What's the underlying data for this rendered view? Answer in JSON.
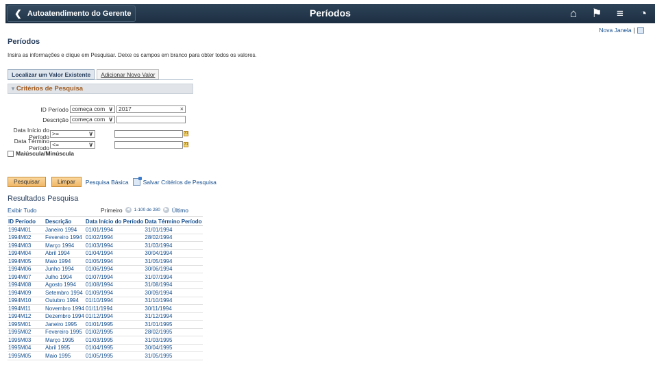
{
  "banner": {
    "back_label": "Autoatendimento do Gerente",
    "title": "Períodos",
    "icons": [
      "home-icon",
      "flag-icon",
      "menu-icon",
      "compass-icon"
    ]
  },
  "new_window": {
    "label": "Nova Janela",
    "separator": "|"
  },
  "page": {
    "title": "Períodos",
    "instructions": "Insira as informações e clique em Pesquisar. Deixe os campos em branco para obter todos os valores."
  },
  "tabs": {
    "find": "Localizar um Valor Existente",
    "add": "Adicionar Novo Valor"
  },
  "criteria": {
    "header": "Critérios de Pesquisa",
    "id": {
      "label": "ID Período",
      "op": "começa com",
      "value": "2017"
    },
    "desc": {
      "label": "Descrição",
      "op": "começa com",
      "value": ""
    },
    "start": {
      "label": "Data Início do Período",
      "op": ">=",
      "value": ""
    },
    "end": {
      "label": "Data Término Período",
      "op": "<=",
      "value": ""
    },
    "case_label": "Maiúscula/Minúscula"
  },
  "buttons": {
    "search": "Pesquisar",
    "clear": "Limpar",
    "basic": "Pesquisa Básica",
    "save": "Salvar Critérios de Pesquisa"
  },
  "results": {
    "title": "Resultados Pesquisa",
    "show_all": "Exibir Tudo",
    "first": "Primeiro",
    "range": "1-100 de 280",
    "last": "Último",
    "headers": [
      "ID Período",
      "Descrição",
      "Data Início do Período",
      "Data Término Período"
    ],
    "rows": [
      [
        "1994M01",
        "Janeiro 1994",
        "01/01/1994",
        "31/01/1994"
      ],
      [
        "1994M02",
        "Fevereiro 1994",
        "01/02/1994",
        "28/02/1994"
      ],
      [
        "1994M03",
        "Março 1994",
        "01/03/1994",
        "31/03/1994"
      ],
      [
        "1994M04",
        "Abril 1994",
        "01/04/1994",
        "30/04/1994"
      ],
      [
        "1994M05",
        "Maio 1994",
        "01/05/1994",
        "31/05/1994"
      ],
      [
        "1994M06",
        "Junho 1994",
        "01/06/1994",
        "30/06/1994"
      ],
      [
        "1994M07",
        "Julho 1994",
        "01/07/1994",
        "31/07/1994"
      ],
      [
        "1994M08",
        "Agosto 1994",
        "01/08/1994",
        "31/08/1994"
      ],
      [
        "1994M09",
        "Setembro 1994",
        "01/09/1994",
        "30/09/1994"
      ],
      [
        "1994M10",
        "Outubro 1994",
        "01/10/1994",
        "31/10/1994"
      ],
      [
        "1994M11",
        "Novembro 1994",
        "01/11/1994",
        "30/11/1994"
      ],
      [
        "1994M12",
        "Dezembro 1994",
        "01/12/1994",
        "31/12/1994"
      ],
      [
        "1995M01",
        "Janeiro 1995",
        "01/01/1995",
        "31/01/1995"
      ],
      [
        "1995M02",
        "Fevereiro 1995",
        "01/02/1995",
        "28/02/1995"
      ],
      [
        "1995M03",
        "Março 1995",
        "01/03/1995",
        "31/03/1995"
      ],
      [
        "1995M04",
        "Abril 1995",
        "01/04/1995",
        "30/04/1995"
      ],
      [
        "1995M05",
        "Maio 1995",
        "01/05/1995",
        "31/05/1995"
      ]
    ]
  }
}
